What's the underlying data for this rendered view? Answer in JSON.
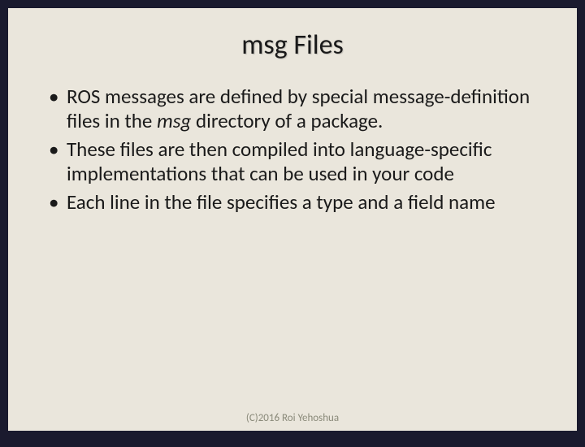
{
  "slide": {
    "title": "msg Files",
    "bullets": [
      {
        "pre": "ROS messages are defined by special message-definition files in the ",
        "italic": "msg",
        "post": " directory of a package."
      },
      {
        "pre": "These files are then compiled into language-specific implementations that can be used in your code",
        "italic": "",
        "post": ""
      },
      {
        "pre": "Each line in the file specifies a type and a field name",
        "italic": "",
        "post": ""
      }
    ],
    "footer": "(C)2016 Roi Yehoshua"
  }
}
